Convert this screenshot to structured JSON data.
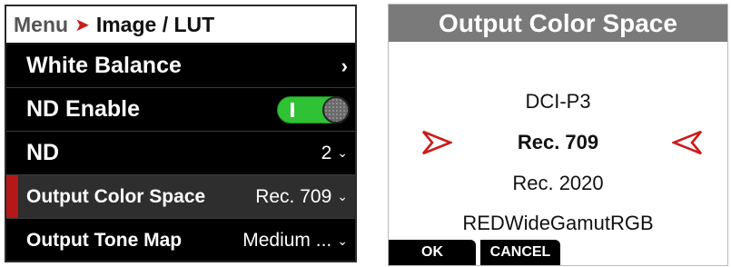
{
  "menu": {
    "breadcrumb": {
      "root": "Menu",
      "separator": "➤",
      "current": "Image / LUT"
    },
    "rows": [
      {
        "label": "White Balance",
        "value": "",
        "chevron": "›"
      },
      {
        "label": "ND Enable",
        "toggle_on": true
      },
      {
        "label": "ND",
        "value": "2",
        "chevron": "⌄"
      },
      {
        "label": "Output Color Space",
        "value": "Rec. 709",
        "chevron": "⌄"
      },
      {
        "label": "Output Tone Map",
        "value": "Medium ...",
        "chevron": "⌄"
      }
    ]
  },
  "picker": {
    "title": "Output Color Space",
    "options": [
      "DCI-P3",
      "Rec. 709",
      "Rec. 2020",
      "REDWideGamutRGB"
    ],
    "selected_index": 1,
    "ok_label": "OK",
    "cancel_label": "CANCEL"
  },
  "colors": {
    "accent_red": "#cc1b1b",
    "toggle_green": "#2fc234",
    "title_bar": "#7a7a7a"
  }
}
